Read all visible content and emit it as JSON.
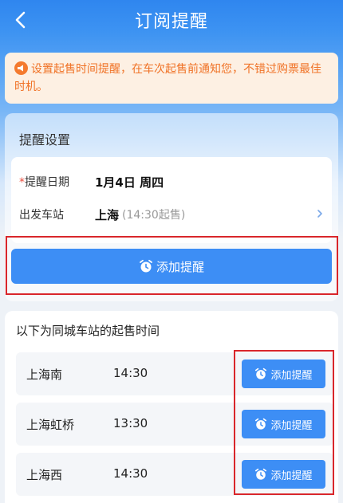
{
  "header": {
    "title": "订阅提醒"
  },
  "notice": {
    "text": "设置起售时间提醒，在车次起售前通知您，不错过购票最佳时机。"
  },
  "settings": {
    "title": "提醒设置",
    "date_required_mark": "*",
    "date_label": "提醒日期",
    "date_value": "1月4日 周四",
    "station_label": "出发车站",
    "station_value": "上海",
    "station_note": "(14:30起售)",
    "add_button": "添加提醒"
  },
  "same_city": {
    "title": "以下为同城车站的起售时间",
    "stations": [
      {
        "name": "上海南",
        "time": "14:30",
        "button": "添加提醒"
      },
      {
        "name": "上海虹桥",
        "time": "13:30",
        "button": "添加提醒"
      },
      {
        "name": "上海西",
        "time": "14:30",
        "button": "添加提醒"
      }
    ]
  },
  "colors": {
    "primary": "#3d8ef5",
    "notice_text": "#f07226",
    "highlight_box": "#d9262b"
  }
}
